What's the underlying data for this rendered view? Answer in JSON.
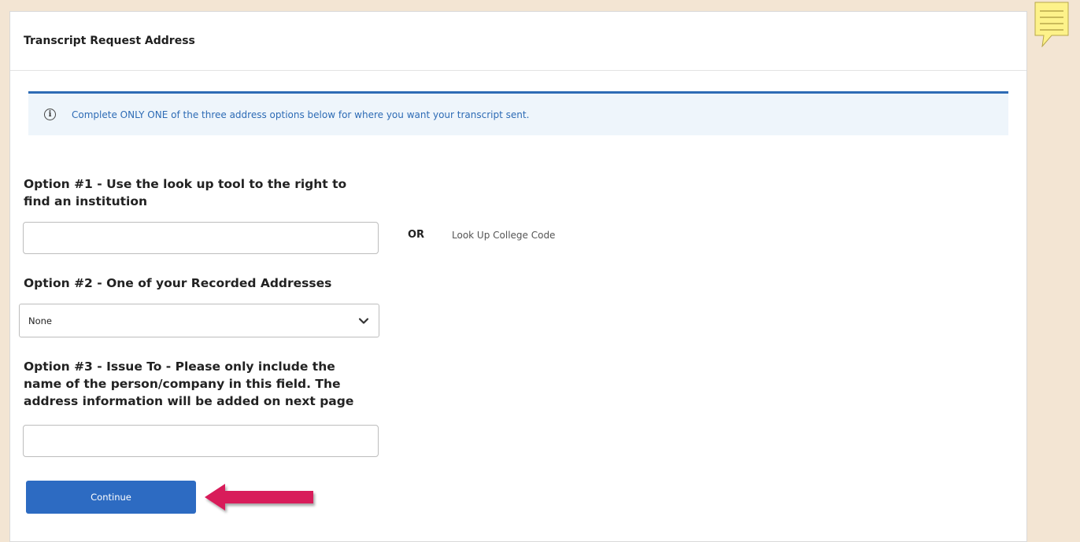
{
  "panel": {
    "title": "Transcript Request Address"
  },
  "info": {
    "message": "Complete ONLY ONE of the three address options below for where you want your transcript sent."
  },
  "option1": {
    "label_line1": "Option #1 - Use the look up tool to the right to",
    "label_line2": "find an institution",
    "value": "",
    "or_text": "OR",
    "lookup_link": "Look Up College Code"
  },
  "option2": {
    "label": "Option #2 - One of your Recorded Addresses",
    "selected": "None"
  },
  "option3": {
    "label_line1": "Option #3 - Issue To - Please only include the",
    "label_line2": "name of the person/company in this field. The",
    "label_line3": "address information will be added on next page",
    "value": ""
  },
  "actions": {
    "continue_label": "Continue"
  },
  "colors": {
    "accent": "#2d6bc2",
    "arrow": "#d81b5a",
    "info_bg": "#eef5fb"
  },
  "icons": {
    "info": "info-circle-icon",
    "dropdown": "chevron-down-icon",
    "note": "sticky-note-icon",
    "pointer": "arrow-left-icon"
  }
}
